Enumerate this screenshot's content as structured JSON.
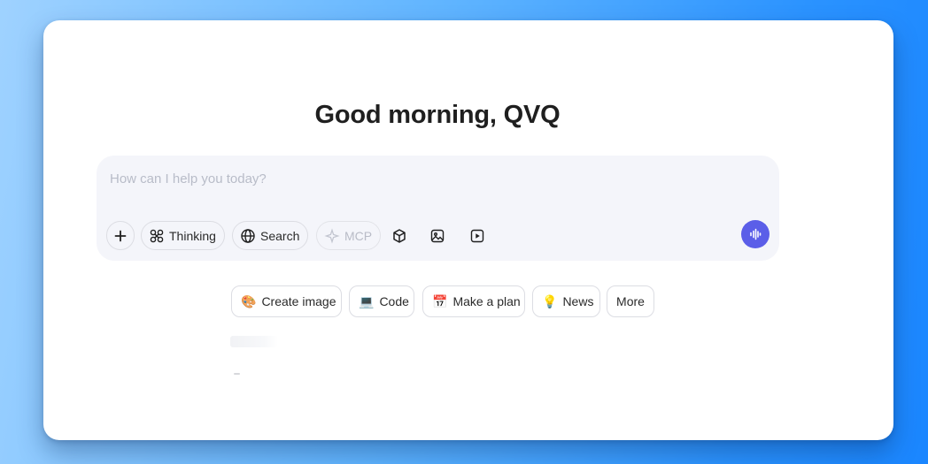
{
  "greeting": "Good morning, QVQ",
  "composer": {
    "placeholder": "How can I help you today?",
    "tools": {
      "thinking_label": "Thinking",
      "search_label": "Search",
      "mcp_label": "MCP"
    }
  },
  "suggestions": [
    {
      "emoji": "🎨",
      "label": "Create image"
    },
    {
      "emoji": "💻",
      "label": "Code"
    },
    {
      "emoji": "📅",
      "label": "Make a plan"
    },
    {
      "emoji": "💡",
      "label": "News"
    },
    {
      "label": "More"
    }
  ],
  "colors": {
    "accent": "#5b5ee8",
    "composer_bg": "#f4f5fa",
    "background_start": "#9fd2ff",
    "background_end": "#1a86ff"
  },
  "icons": [
    "plus-icon",
    "thinking-icon",
    "globe-icon",
    "mcp-icon",
    "cube-icon",
    "image-icon",
    "video-icon",
    "voice-wave-icon"
  ]
}
